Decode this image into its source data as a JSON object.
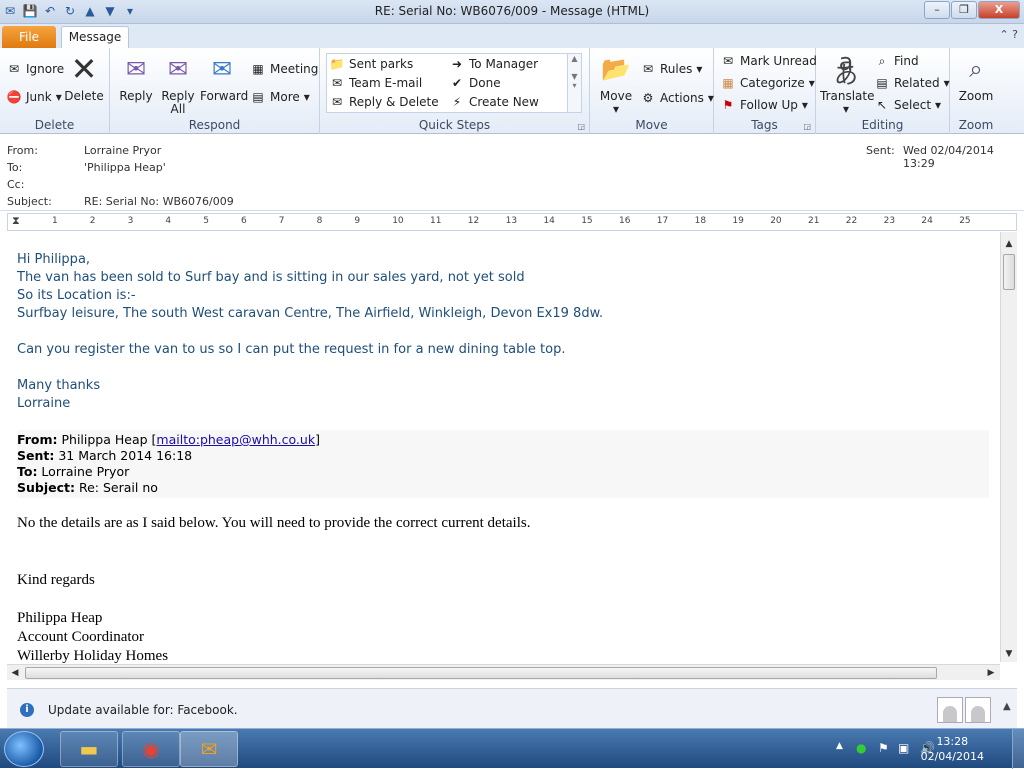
{
  "window": {
    "title": "RE: Serial No: WB6076/009  -  Message (HTML)",
    "min": "–",
    "max": "❐",
    "close": "X"
  },
  "tabs": {
    "file": "File",
    "message": "Message"
  },
  "ribbon": {
    "delete_group": {
      "label": "Delete",
      "ignore": "Ignore",
      "junk": "Junk",
      "delete": "Delete"
    },
    "respond_group": {
      "label": "Respond",
      "reply": "Reply",
      "reply_all_1": "Reply",
      "reply_all_2": "All",
      "forward": "Forward",
      "meeting": "Meeting",
      "more": "More"
    },
    "quicksteps_group": {
      "label": "Quick Steps",
      "items": [
        "Sent parks",
        "To Manager",
        "Team E-mail",
        "Done",
        "Reply & Delete",
        "Create New"
      ]
    },
    "move_group": {
      "label": "Move",
      "move": "Move",
      "rules": "Rules",
      "actions": "Actions"
    },
    "tags_group": {
      "label": "Tags",
      "mark_unread": "Mark Unread",
      "categorize": "Categorize",
      "follow_up": "Follow Up"
    },
    "editing_group": {
      "label": "Editing",
      "translate": "Translate",
      "find": "Find",
      "related": "Related",
      "select": "Select"
    },
    "zoom_group": {
      "label": "Zoom",
      "zoom": "Zoom"
    }
  },
  "header": {
    "from_label": "From:",
    "from_value": "Lorraine Pryor",
    "to_label": "To:",
    "to_value": "'Philippa Heap'",
    "cc_label": "Cc:",
    "subject_label": "Subject:",
    "subject_value": "RE: Serial No: WB6076/009",
    "sent_label": "Sent:",
    "sent_value": "Wed 02/04/2014 13:29"
  },
  "ruler": {
    "ticks": [
      "1",
      "2",
      "3",
      "4",
      "5",
      "6",
      "7",
      "8",
      "9",
      "10",
      "11",
      "12",
      "13",
      "14",
      "15",
      "16",
      "17",
      "18",
      "19",
      "20",
      "21",
      "22",
      "23",
      "24",
      "25"
    ]
  },
  "message": {
    "greeting": "Hi Philippa,",
    "line1": "The van has been sold to Surf bay and is sitting in our sales yard, not yet sold",
    "line2": "So its Location is:-",
    "line3": "Surfbay leisure, The south West caravan Centre, The Airfield, Winkleigh, Devon Ex19 8dw.",
    "line4": "Can you register the van to us so I can put the request in for a new dining table top.",
    "thanks": "Many thanks",
    "signoff": "Lorraine"
  },
  "quoted": {
    "from_label": "From:",
    "from_name": " Philippa Heap [",
    "from_link": "mailto:pheap@whh.co.uk",
    "from_end": "]",
    "sent_label": "Sent:",
    "sent_value": " 31 March 2014 16:18",
    "to_label": "To:",
    "to_value": " Lorraine Pryor",
    "subject_label": "Subject:",
    "subject_value": " Re: Serail no",
    "body": "No the details are as I said below.  You will need to provide the correct current details.",
    "regards": "Kind regards",
    "sig_name": "Philippa Heap",
    "sig_title": "Account Coordinator",
    "sig_company": "Willerby Holiday Homes"
  },
  "infobar": {
    "text": "Update available for: Facebook."
  },
  "taskbar": {
    "time": "13:28",
    "date": "02/04/2014"
  }
}
